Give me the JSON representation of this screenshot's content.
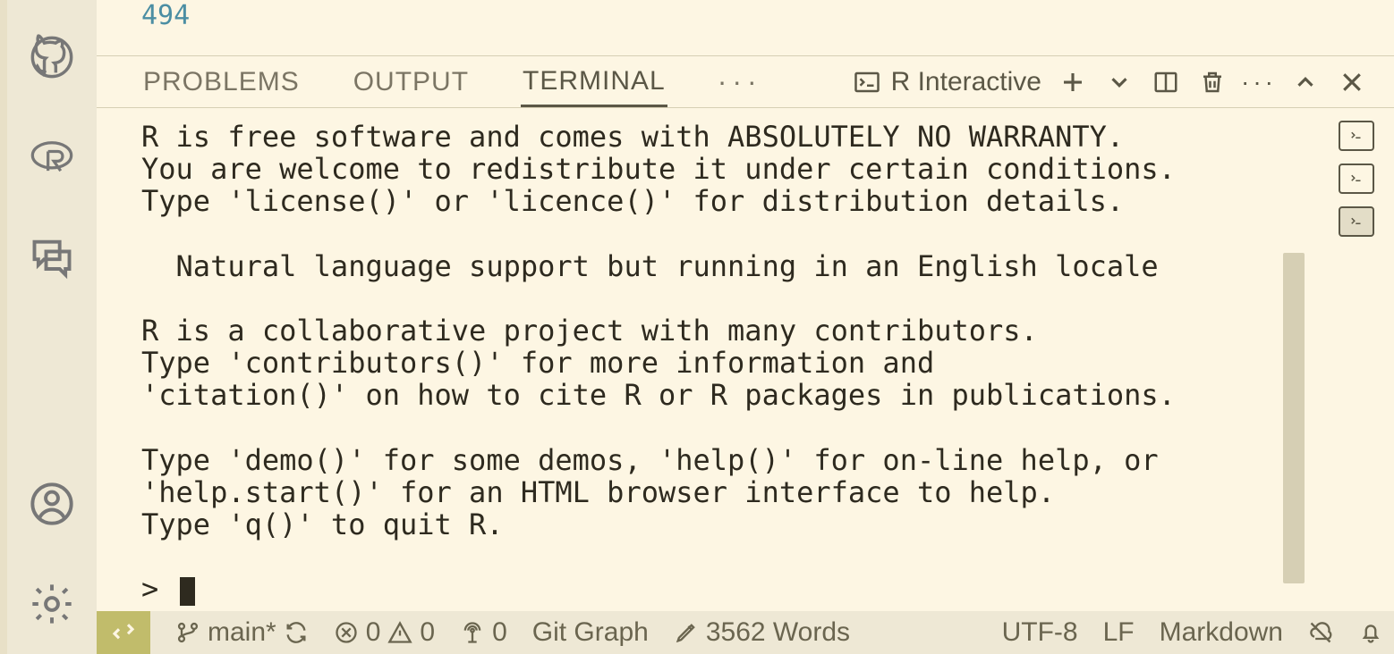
{
  "editor": {
    "line_number": "494"
  },
  "panel": {
    "tabs": {
      "problems": "PROBLEMS",
      "output": "OUTPUT",
      "terminal": "TERMINAL"
    },
    "terminal_label": "R Interactive"
  },
  "terminal_output": "R is free software and comes with ABSOLUTELY NO WARRANTY.\nYou are welcome to redistribute it under certain conditions.\nType 'license()' or 'licence()' for distribution details.\n\n  Natural language support but running in an English locale\n\nR is a collaborative project with many contributors.\nType 'contributors()' for more information and\n'citation()' on how to cite R or R packages in publications.\n\nType 'demo()' for some demos, 'help()' for on-line help, or\n'help.start()' for an HTML browser interface to help.\nType 'q()' to quit R.\n",
  "terminal_prompt": "> ",
  "status": {
    "branch": "main*",
    "errors": "0",
    "warnings": "0",
    "ports": "0",
    "git_graph": "Git Graph",
    "words": "3562 Words",
    "encoding": "UTF-8",
    "eol": "LF",
    "language": "Markdown"
  }
}
